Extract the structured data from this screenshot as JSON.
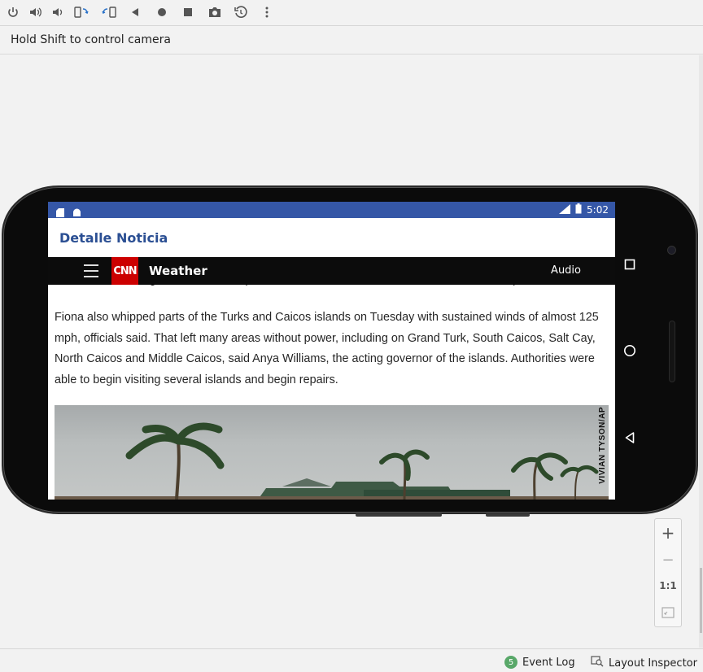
{
  "toolbar": {
    "buttons": [
      {
        "name": "power-button",
        "icon": "power-icon"
      },
      {
        "name": "volume-up-button",
        "icon": "volume-up-icon"
      },
      {
        "name": "volume-down-button",
        "icon": "volume-down-icon"
      },
      {
        "name": "rotate-left-button",
        "icon": "rotate-left-icon"
      },
      {
        "name": "rotate-right-button",
        "icon": "rotate-right-icon"
      },
      {
        "name": "back-button",
        "icon": "back-icon"
      },
      {
        "name": "home-button",
        "icon": "home-icon"
      },
      {
        "name": "overview-button",
        "icon": "overview-icon"
      },
      {
        "name": "screenshot-button",
        "icon": "camera-icon"
      },
      {
        "name": "snapshot-button",
        "icon": "snapshot-icon"
      },
      {
        "name": "more-button",
        "icon": "more-vert-icon"
      }
    ]
  },
  "hint": {
    "text": "Hold Shift to control camera"
  },
  "device": {
    "status_bar": {
      "time": "5:02",
      "accent": "#3557a7"
    },
    "app_bar": {
      "title": "Detalle Noticia"
    },
    "cnn_header": {
      "logo": "CNN",
      "section": "Weather",
      "audio": "Audio"
    },
    "article": {
      "clipped_line": "this week, including one in Guadeloupe, two in Puerto Rico and two in the Dominican Republic.",
      "paragraph": "Fiona also whipped parts of the Turks and Caicos islands on Tuesday with sustained winds of almost 125 mph, officials said. That left many areas without power, including on Grand Turk, South Caicos, Salt Cay, North Caicos and Middle Caicos, said Anya Williams, the acting governor of the islands. Authorities were able to begin visiting several islands and begin repairs.",
      "photo_credit": "VIVIAN TYSON/AP"
    }
  },
  "zoom": {
    "plus": "+",
    "minus": "−",
    "one_to_one": "1:1"
  },
  "bottom": {
    "event_log_count": "5",
    "event_log": "Event Log",
    "layout_inspector": "Layout Inspector"
  }
}
